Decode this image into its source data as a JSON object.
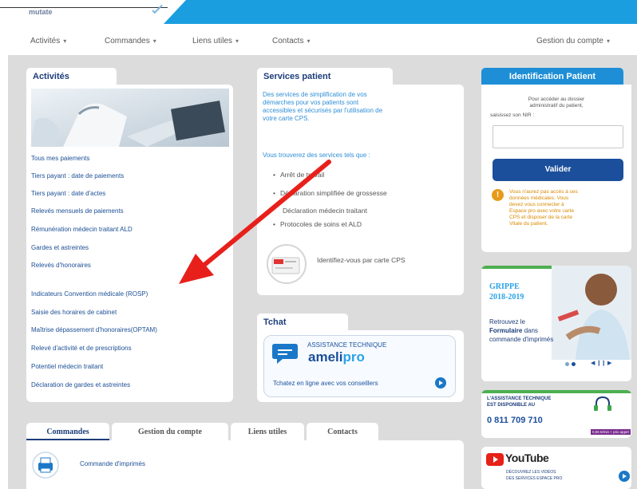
{
  "header": {
    "brand": "mutate"
  },
  "nav": {
    "items": [
      {
        "label": "Activités"
      },
      {
        "label": "Commandes"
      },
      {
        "label": "Liens utiles"
      },
      {
        "label": "Contacts"
      }
    ],
    "account": "Gestion du compte"
  },
  "activites": {
    "title": "Activités",
    "links": [
      "Tous mes paiements",
      "Tiers payant : date de paiements",
      "Tiers payant : date d'actes",
      "Relevés mensuels de paiements",
      "Rémunération médecin traitant ALD",
      "Gardes et astreintes",
      "Relevés d'honoraires",
      "Indicateurs Convention médicale (ROSP)",
      "Saisie des horaires de cabinet",
      "Maîtrise dépassement d'honoraires(OPTAM)",
      "Relevé d'activité et de prescriptions",
      "Potentiel médecin traitant",
      "Déclaration de gardes et astreintes"
    ]
  },
  "services": {
    "title": "Services patient",
    "intro": [
      "Des services de simplification de vos",
      "démarches pour vos patients sont",
      "accessibles et sécurisés par l'utilisation de",
      "votre carte CPS."
    ],
    "list_intro": "Vous trouverez des services tels que :",
    "items": [
      "Arrêt de travail",
      "Déclaration simplifiée de grossesse",
      "Déclaration médecin traitant",
      "Protocoles de soins et ALD"
    ],
    "cps_link": "Identifiez-vous par carte CPS"
  },
  "tchat": {
    "title": "Tchat",
    "banner_title": "ASSISTANCE TECHNIQUE",
    "banner_brand_a": "ameli",
    "banner_brand_b": "pro",
    "banner_text": "Tchatez en ligne avec vos conseillers"
  },
  "identification": {
    "title": "Identification Patient",
    "help": [
      "Pour accéder au dossier",
      "administratif du patient,"
    ],
    "nir_label": "saisissez son NIR :",
    "nir_value": "",
    "button": "Valider",
    "warning": [
      "Vous n'aurez pas accès à ses",
      "données médicales. Vous",
      "devez vous connecter à",
      "Espace pro avec votre carte",
      "CPS et disposer de la carte",
      "Vitale du patient."
    ]
  },
  "grippe": {
    "title_line1": "GRIPPE",
    "title_line2": "2018-2019",
    "text_a": "Retrouvez le",
    "text_b": "Formulaire",
    "text_c": "dans",
    "text_d": "commande d'imprimés",
    "pager": "◀ ❙❙ ▶"
  },
  "assistance": {
    "line1": "L'ASSISTANCE TECHNIQUE",
    "line2": "EST DISPONIBLE AU",
    "phone": "0 811 709 710",
    "price": "0,06 €/min + prix appel"
  },
  "youtube": {
    "brand": "YouTube",
    "line1": "DÉCOUVREZ LES VIDÉOS",
    "line2": "DES SERVICES ESPACE PRO"
  },
  "bottom_tabs": [
    "Commandes",
    "Gestion du compte",
    "Liens utiles",
    "Contacts"
  ],
  "commandes": {
    "item": "Commande d'imprimés"
  },
  "colors": {
    "accent": "#1e8fd6",
    "navy": "#1b4f9c",
    "arrow": "#e8201c",
    "warning": "#e89a1a"
  }
}
